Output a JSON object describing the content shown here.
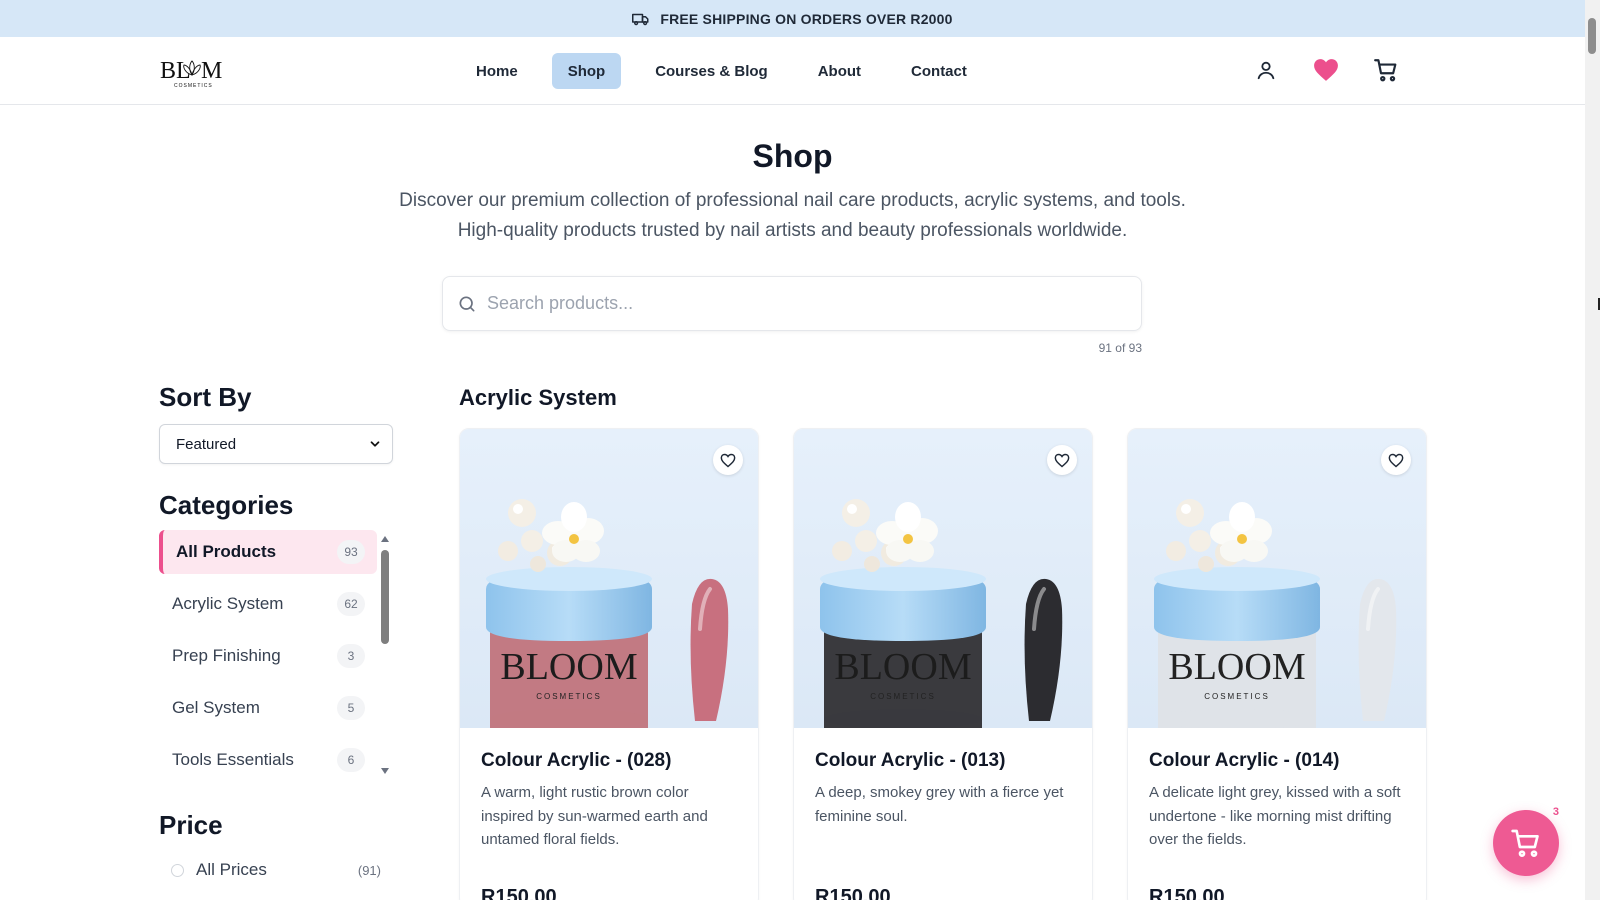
{
  "announcement": {
    "text": "FREE SHIPPING ON ORDERS OVER R2000",
    "icon": "truck-icon"
  },
  "header": {
    "logo_text": "BLOOM",
    "logo_subtext": "COSMETICS",
    "nav": [
      {
        "label": "Home",
        "active": false
      },
      {
        "label": "Shop",
        "active": true
      },
      {
        "label": "Courses & Blog",
        "active": false
      },
      {
        "label": "About",
        "active": false
      },
      {
        "label": "Contact",
        "active": false
      }
    ],
    "icons": [
      "user-icon",
      "heart-icon",
      "cart-icon"
    ]
  },
  "hero": {
    "title": "Shop",
    "subtitle_line1": "Discover our premium collection of professional nail care products, acrylic systems, and tools.",
    "subtitle_line2": "High-quality products trusted by nail artists and beauty professionals worldwide."
  },
  "search": {
    "placeholder": "Search products...",
    "value": "",
    "result_count": "91 of 93"
  },
  "sidebar": {
    "sort_title": "Sort By",
    "sort_value": "Featured",
    "categories_title": "Categories",
    "categories": [
      {
        "label": "All Products",
        "count": "93",
        "active": true
      },
      {
        "label": "Acrylic System",
        "count": "62",
        "active": false
      },
      {
        "label": "Prep Finishing",
        "count": "3",
        "active": false
      },
      {
        "label": "Gel System",
        "count": "5",
        "active": false
      },
      {
        "label": "Tools Essentials",
        "count": "6",
        "active": false
      }
    ],
    "price_title": "Price",
    "price_options": [
      {
        "label": "All Prices",
        "count": "(91)"
      }
    ]
  },
  "products_section": {
    "title": "Acrylic System",
    "products": [
      {
        "name": "Colour Acrylic - (028)",
        "description": "A warm, light rustic brown color inspired by sun-warmed earth and untamed floral fields.",
        "price": "R150.00",
        "jar_color": "#c27a83",
        "nail_color": "#c8707f",
        "label_text": "BLOOM",
        "label_sub": "COSMETICS"
      },
      {
        "name": "Colour Acrylic - (013)",
        "description": "A deep, smokey grey with a fierce yet feminine soul.",
        "price": "R150.00",
        "jar_color": "#3a3a3e",
        "nail_color": "#2c2c30",
        "label_text": "BLOOM",
        "label_sub": "COSMETICS"
      },
      {
        "name": "Colour Acrylic - (014)",
        "description": "A delicate light grey, kissed with a soft undertone - like morning mist drifting over the fields.",
        "price": "R150.00",
        "jar_color": "#dfe3e8",
        "nail_color": "#e3e7ec",
        "label_text": "BLOOM",
        "label_sub": "COSMETICS"
      }
    ]
  },
  "floating_cart": {
    "badge": "3",
    "icon": "cart-icon"
  },
  "colors": {
    "accent_pink": "#ec4f8d",
    "nav_active_bg": "#bcd7f2",
    "announcement_bg": "#d6e7f7"
  }
}
